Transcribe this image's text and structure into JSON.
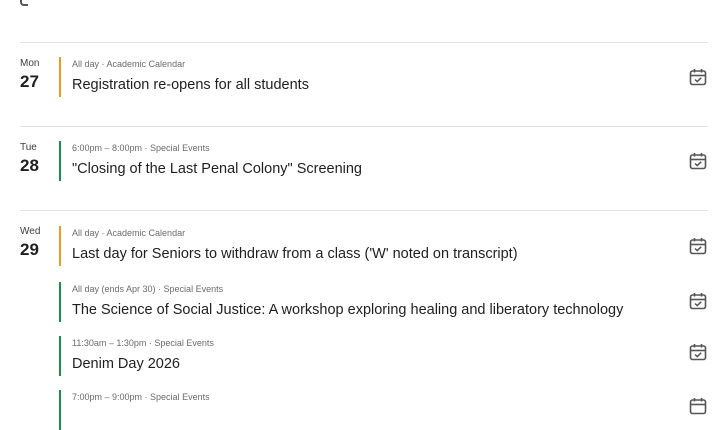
{
  "colors": {
    "academic": "#e3a021",
    "special": "#1e8a4c"
  },
  "days": [
    {
      "dow": "Mon",
      "num": "27"
    },
    {
      "dow": "Tue",
      "num": "28"
    },
    {
      "dow": "Wed",
      "num": "29"
    }
  ],
  "events": [
    {
      "time": "All day",
      "category": "Academic Calendar",
      "title": "Registration re-opens for all students",
      "icon": "calendar-add-icon"
    },
    {
      "time": "6:00pm – 8:00pm",
      "category": "Special Events",
      "title": "\"Closing of the Last Penal Colony\" Screening",
      "icon": "calendar-add-icon"
    },
    {
      "time": "All day",
      "category": "Academic Calendar",
      "title": "Last day for Seniors to withdraw from a class ('W' noted on transcript)",
      "icon": "calendar-add-icon"
    },
    {
      "time": "All day (ends Apr 30)",
      "category": "Special Events",
      "title": "The Science of Social Justice: A workshop exploring healing and liberatory technology",
      "icon": "calendar-add-icon"
    },
    {
      "time": "11:30am – 1:30pm",
      "category": "Special Events",
      "title": "Denim Day 2026",
      "icon": "calendar-add-icon"
    },
    {
      "time": "7:00pm – 9:00pm",
      "category": "Special Events",
      "title": "",
      "icon": "calendar-add-icon"
    }
  ]
}
